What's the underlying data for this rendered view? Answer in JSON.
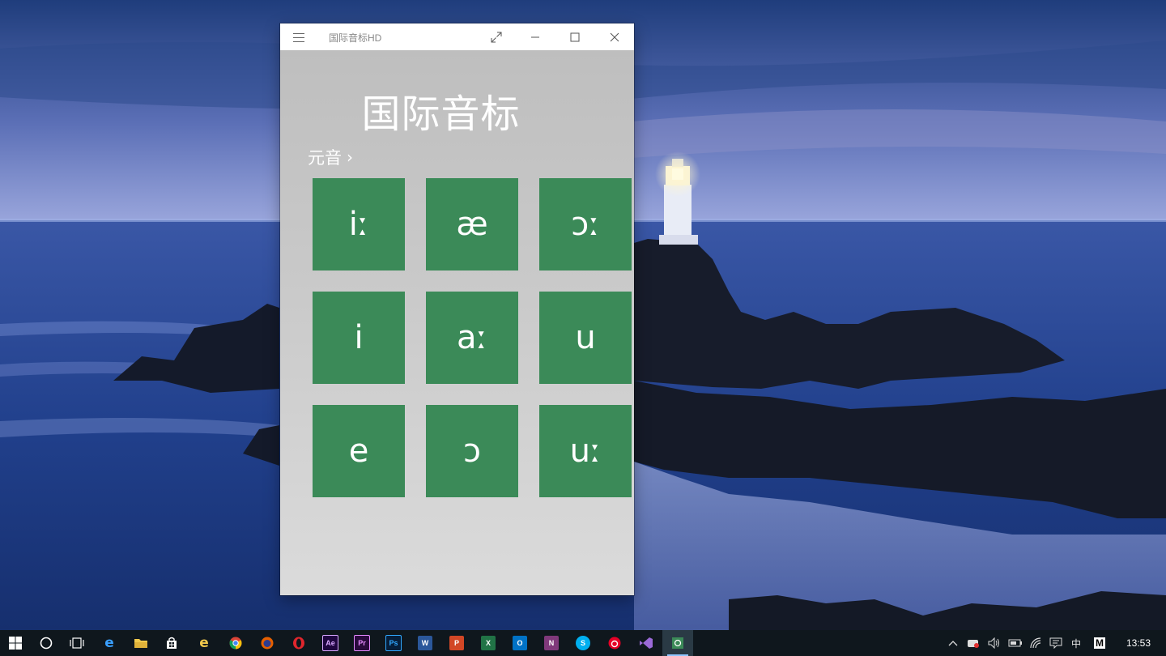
{
  "window": {
    "title": "国际音标HD",
    "buttons": [
      "fullscreen-icon",
      "minimize-icon",
      "maximize-icon",
      "close-icon"
    ]
  },
  "app": {
    "heading": "国际音标",
    "section_label": "元音",
    "section_chevron": "›",
    "symbols": [
      "iː",
      "æ",
      "ɔː",
      "i",
      "aː",
      "u",
      "e",
      "ɔ",
      "uː"
    ],
    "tile_color": "#3b8a58"
  },
  "taskbar": {
    "icons": [
      "windows-start-icon",
      "cortana-search-icon",
      "task-view-icon",
      "edge-icon",
      "file-explorer-icon",
      "store-icon",
      "internet-explorer-icon",
      "chrome-icon",
      "firefox-icon",
      "opera-icon",
      "after-effects-icon",
      "premiere-icon",
      "photoshop-icon",
      "word-icon",
      "powerpoint-icon",
      "excel-icon",
      "outlook-icon",
      "onenote-icon",
      "skype-icon",
      "netease-music-icon",
      "visual-studio-icon",
      "phonetics-app-icon"
    ],
    "app_labels": {
      "ae": "Ae",
      "pr": "Pr",
      "ps": "Ps",
      "w": "W",
      "p": "P",
      "x": "X",
      "o": "O",
      "n": "N",
      "s": "S"
    },
    "tray": {
      "ime": "中",
      "ime_mode": "M",
      "time": "13:53"
    }
  }
}
